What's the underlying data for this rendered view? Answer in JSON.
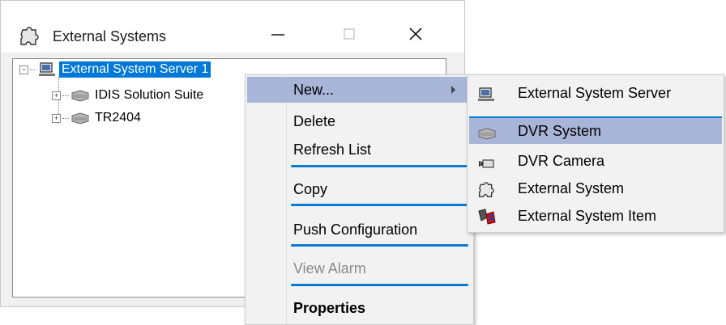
{
  "window": {
    "title": "External Systems",
    "buttons": {
      "minimize": "minimize",
      "maximize": "maximize",
      "close": "close"
    }
  },
  "tree": {
    "root": {
      "label": "External System Server 1",
      "icon": "server-icon"
    },
    "children": [
      {
        "label": "IDIS Solution Suite",
        "icon": "dvr-icon"
      },
      {
        "label": "TR2404",
        "icon": "dvr-icon"
      }
    ]
  },
  "context_menu": {
    "new": "New...",
    "delete": "Delete",
    "refresh": "Refresh List",
    "copy": "Copy",
    "push": "Push Configuration",
    "view_alarm": "View Alarm",
    "properties": "Properties"
  },
  "submenu": {
    "items": [
      {
        "label": "External System Server",
        "icon": "server-icon"
      },
      {
        "label": "DVR System",
        "icon": "dvr-icon"
      },
      {
        "label": "DVR Camera",
        "icon": "camera-icon"
      },
      {
        "label": "External System",
        "icon": "puzzle-icon"
      },
      {
        "label": "External System Item",
        "icon": "plug-icon"
      }
    ]
  },
  "colors": {
    "selection": "#0078d7",
    "menu_highlight": "#a9b4d9",
    "separator": "#0a7bd6"
  }
}
